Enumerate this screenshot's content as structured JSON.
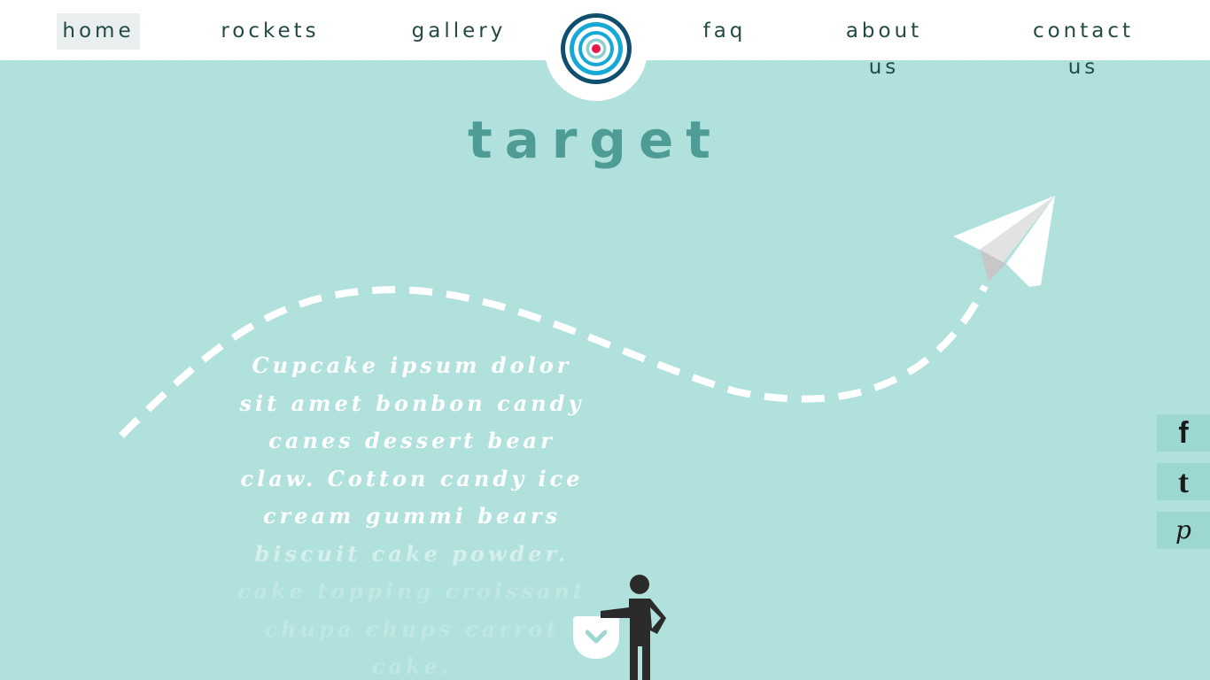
{
  "nav": {
    "items": [
      {
        "label": "home",
        "active": true
      },
      {
        "label": "rockets",
        "active": false
      },
      {
        "label": "gallery",
        "active": false
      },
      {
        "label": "faq",
        "active": false
      },
      {
        "label": "about us",
        "active": false
      },
      {
        "label": "contact us",
        "active": false
      }
    ]
  },
  "logo": {
    "icon": "target-icon"
  },
  "hero": {
    "title": "target",
    "blurb": "Cupcake ipsum dolor sit amet bonbon candy canes dessert bear claw. Cotton candy ice cream gummi bears biscuit cake powder. cake topping croissant chupa chups carrot cake."
  },
  "scroll_button": {
    "icon": "chevron-down-icon"
  },
  "social": [
    {
      "name": "facebook",
      "glyph": "f"
    },
    {
      "name": "tumblr",
      "glyph": "t"
    },
    {
      "name": "pinterest",
      "glyph": "p"
    }
  ],
  "colors": {
    "background": "#b0e1dd",
    "header": "#ffffff",
    "nav_text": "#244a46",
    "title": "#4f9c96",
    "target_outer": "#0e4f6e",
    "target_inner": "#17a9d6",
    "target_center": "#e5194d",
    "social_bg": "#9cd7d2"
  }
}
